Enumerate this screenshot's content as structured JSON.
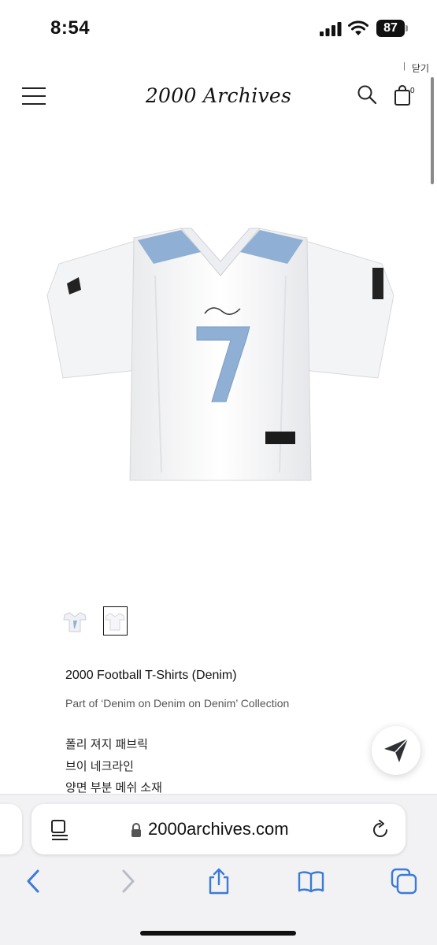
{
  "status_bar": {
    "time": "8:54",
    "battery": "87"
  },
  "top_link": {
    "separator": "|",
    "close_label": "닫기"
  },
  "header": {
    "brand": "2000 Archives",
    "cart_count": "0"
  },
  "product": {
    "title": "2000 Football T-Shirts (Denim)",
    "subtitle": "Part of ‘Denim on Denim on Denim’ Collection",
    "description": [
      "폴리 져지 패브릭",
      "브이 네크라인",
      "양면 부분 메쉬 소재"
    ],
    "thumbnail_count": 2,
    "selected_thumbnail": 2,
    "jersey_number": "7"
  },
  "browser": {
    "url": "2000archives.com"
  },
  "colors": {
    "denim_accent": "#8fb0d4",
    "page_background": "#ffffff",
    "toolbar_blue": "#3a7bd5",
    "toolbar_background": "#f2f2f5"
  },
  "icons": [
    "signal-icon",
    "wifi-icon",
    "battery-icon",
    "menu-icon",
    "search-icon",
    "cart-icon",
    "share-paper-plane-icon",
    "reader-icon",
    "lock-icon",
    "reload-icon",
    "back-icon",
    "forward-icon",
    "share-icon",
    "bookmarks-icon",
    "tabs-icon"
  ]
}
